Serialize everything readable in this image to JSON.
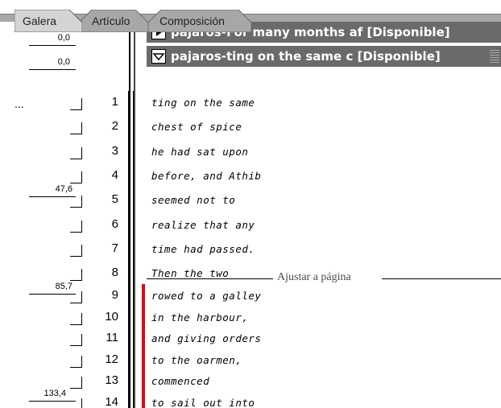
{
  "tabs": [
    {
      "label": "Galera",
      "active": true
    },
    {
      "label": "Artículo",
      "active": false
    },
    {
      "label": "Composición",
      "active": false
    }
  ],
  "stories": [
    {
      "title": "pajaros-For many months af [Disponible]",
      "expanded": false,
      "icon": "triangle-right-icon"
    },
    {
      "title": "pajaros-ting on the same c [Disponible]",
      "expanded": true,
      "icon": "triangle-down-icon"
    }
  ],
  "story_depths": [
    "0,0",
    "0,0"
  ],
  "overflow_indicator": "...",
  "fit_label": "Ajustar a página",
  "depth_markers": {
    "line5": "47,6",
    "line9": "85,7",
    "line14": "133,4"
  },
  "lines": [
    {
      "n": "1",
      "text": "ting on the same"
    },
    {
      "n": "2",
      "text": "chest of spice"
    },
    {
      "n": "3",
      "text": "he had sat upon"
    },
    {
      "n": "4",
      "text": "before, and Athib"
    },
    {
      "n": "5",
      "text": "seemed not to"
    },
    {
      "n": "6",
      "text": "realize that any"
    },
    {
      "n": "7",
      "text": "time had passed."
    },
    {
      "n": "8",
      "text": "Then the two"
    },
    {
      "n": "9",
      "text": "rowed to a galley"
    },
    {
      "n": "10",
      "text": "in the harbour,"
    },
    {
      "n": "11",
      "text": "and giving orders"
    },
    {
      "n": "12",
      "text": "to the oarmen,"
    },
    {
      "n": "13",
      "text": "commenced"
    },
    {
      "n": "14",
      "text": "to sail out into"
    }
  ],
  "colors": {
    "header_bg": "#6a6a6a",
    "overset_marker": "#e2001a",
    "tab_bg": "#a7a7a7"
  }
}
